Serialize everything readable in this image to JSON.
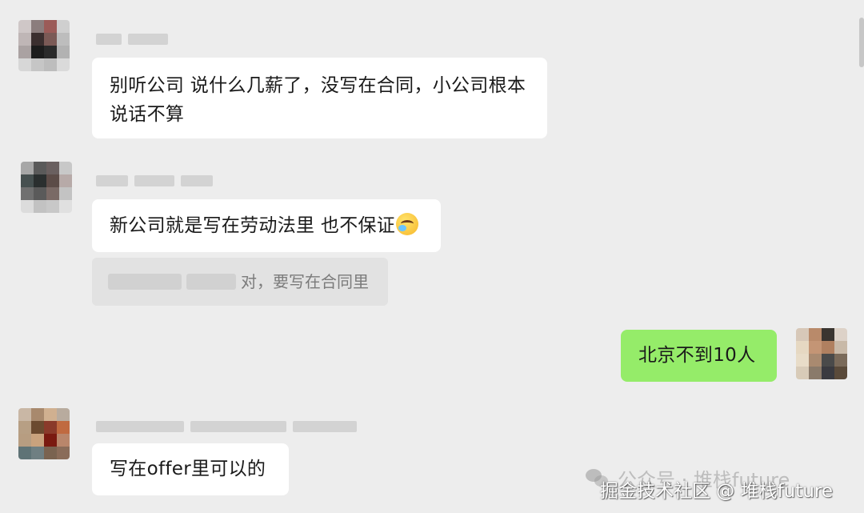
{
  "messages": [
    {
      "id": "m1",
      "text": "别听公司 说什么几薪了，没写在合同，小公司根本说话不算"
    },
    {
      "id": "m2",
      "text": "新公司就是写在劳动法里 也不保证"
    },
    {
      "id": "m2_quote",
      "text": "对，要写在合同里"
    },
    {
      "id": "m3",
      "text": "北京不到10人"
    },
    {
      "id": "m4",
      "text": "写在offer里可以的"
    }
  ],
  "watermark": {
    "line1": "公众号 · 堆栈future",
    "line2": "掘金技术社区 @ 堆栈future"
  },
  "icons": {
    "emoji": "crying-laughing-emoji",
    "watermark": "wechat-icon"
  },
  "colors": {
    "background": "#ededed",
    "self_bubble": "#95ec69",
    "other_bubble": "#ffffff"
  }
}
